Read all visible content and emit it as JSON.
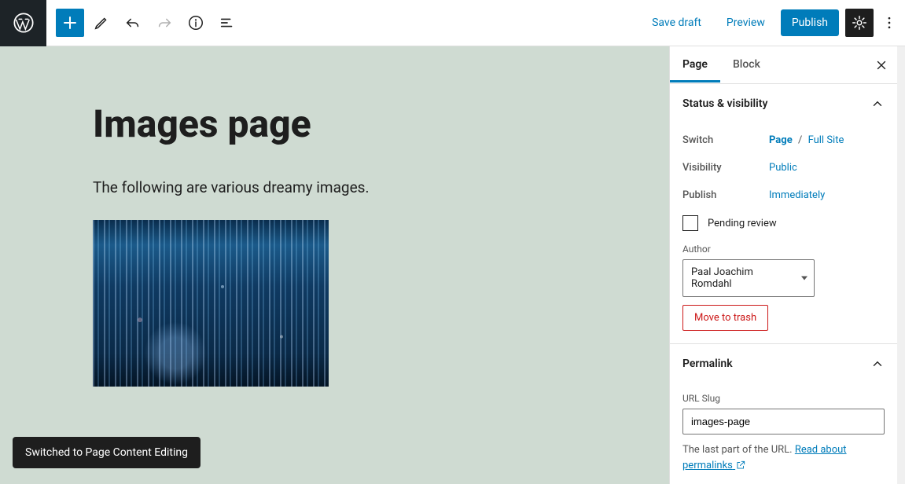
{
  "toolbar": {
    "save_draft": "Save draft",
    "preview": "Preview",
    "publish": "Publish"
  },
  "content": {
    "title": "Images page",
    "paragraph": "The following are various dreamy images."
  },
  "toast": "Switched to Page Content Editing",
  "sidebar": {
    "tabs": {
      "page": "Page",
      "block": "Block"
    },
    "status": {
      "header": "Status & visibility",
      "switch_label": "Switch",
      "switch_page": "Page",
      "switch_fullsite": "Full Site",
      "visibility_label": "Visibility",
      "visibility_value": "Public",
      "publish_label": "Publish",
      "publish_value": "Immediately",
      "pending_review": "Pending review",
      "author_label": "Author",
      "author_value": "Paal Joachim Romdahl",
      "trash": "Move to trash"
    },
    "permalink": {
      "header": "Permalink",
      "slug_label": "URL Slug",
      "slug_value": "images-page",
      "help_prefix": "The last part of the URL. ",
      "help_link": "Read about permalinks"
    }
  }
}
